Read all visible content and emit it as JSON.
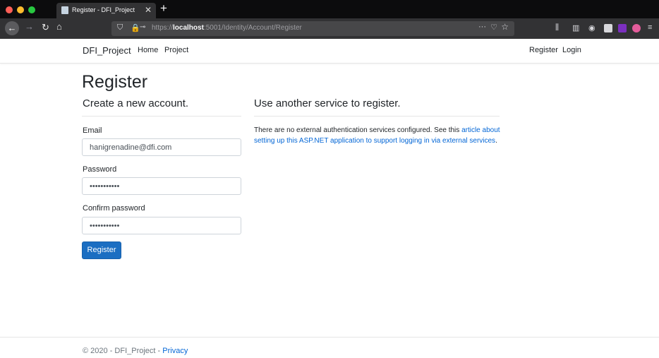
{
  "browser": {
    "tab_title": "Register - DFI_Project",
    "url_prefix": "https://",
    "url_host": "localhost",
    "url_rest": ":5001/Identity/Account/Register",
    "icons": {
      "back": "←",
      "forward": "→",
      "reload": "↻",
      "home": "⌂",
      "shield": "⛉",
      "lock": "🔒",
      "key": "⊸",
      "more": "···",
      "pocket": "♡",
      "star": "☆",
      "library": "⫼",
      "sidebar": "▥",
      "account": "◉",
      "menu": "≡",
      "close": "✕",
      "plus": "+"
    }
  },
  "header": {
    "brand": "DFI_Project",
    "nav": [
      "Home",
      "Project"
    ],
    "right_nav": [
      "Register",
      "Login"
    ]
  },
  "main": {
    "title": "Register",
    "form_heading": "Create a new account.",
    "email_label": "Email",
    "email_value": "hanigrenadine@dfi.com",
    "password_label": "Password",
    "password_value": "•••••••••••",
    "confirm_label": "Confirm password",
    "confirm_value": "•••••••••••",
    "submit_label": "Register",
    "external_heading": "Use another service to register.",
    "external_text": "There are no external authentication services configured. See this ",
    "external_link": "article about setting up this ASP.NET application to support logging in via external services",
    "external_end": "."
  },
  "footer": {
    "text": "© 2020 - DFI_Project - ",
    "privacy": "Privacy"
  },
  "colors": {
    "accent": "#1b6ec2",
    "link": "#0366d6"
  }
}
